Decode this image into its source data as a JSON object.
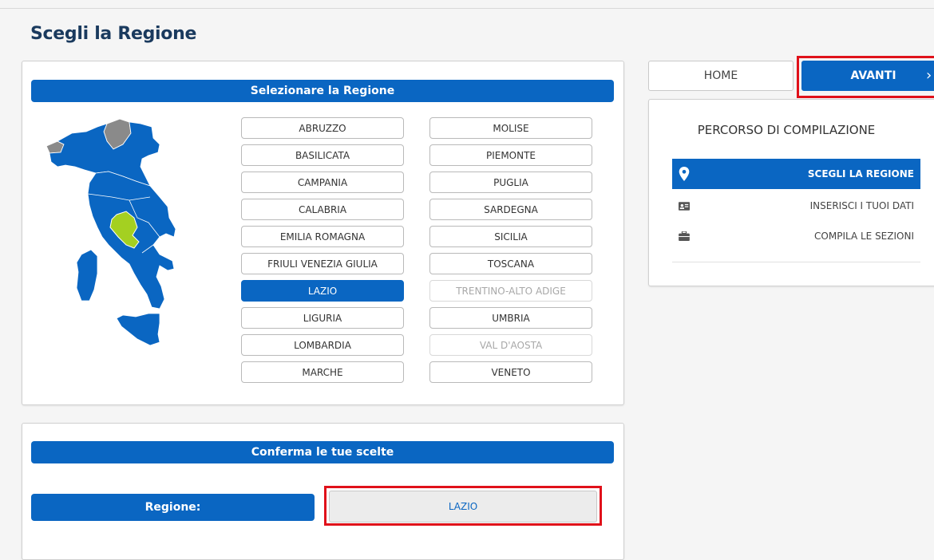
{
  "page_title": "Scegli la Regione",
  "select_card": {
    "header": "Selezionare la Regione",
    "regions_left": [
      {
        "label": "ABRUZZO",
        "state": "normal"
      },
      {
        "label": "BASILICATA",
        "state": "normal"
      },
      {
        "label": "CAMPANIA",
        "state": "normal"
      },
      {
        "label": "CALABRIA",
        "state": "normal"
      },
      {
        "label": "EMILIA ROMAGNA",
        "state": "normal"
      },
      {
        "label": "FRIULI VENEZIA GIULIA",
        "state": "normal"
      },
      {
        "label": "LAZIO",
        "state": "selected"
      },
      {
        "label": "LIGURIA",
        "state": "normal"
      },
      {
        "label": "LOMBARDIA",
        "state": "normal"
      },
      {
        "label": "MARCHE",
        "state": "normal"
      }
    ],
    "regions_right": [
      {
        "label": "MOLISE",
        "state": "normal"
      },
      {
        "label": "PIEMONTE",
        "state": "normal"
      },
      {
        "label": "PUGLIA",
        "state": "normal"
      },
      {
        "label": "SARDEGNA",
        "state": "normal"
      },
      {
        "label": "SICILIA",
        "state": "normal"
      },
      {
        "label": "TOSCANA",
        "state": "normal"
      },
      {
        "label": "TRENTINO-ALTO ADIGE",
        "state": "disabled"
      },
      {
        "label": "UMBRIA",
        "state": "normal"
      },
      {
        "label": "VAL D'AOSTA",
        "state": "disabled"
      },
      {
        "label": "VENETO",
        "state": "normal"
      }
    ]
  },
  "confirm_card": {
    "header": "Conferma le tue scelte",
    "region_label": "Regione:",
    "region_value": "LAZIO"
  },
  "nav": {
    "home_label": "HOME",
    "next_label": "AVANTI",
    "next_icon": "chevron-right-icon"
  },
  "path": {
    "title": "PERCORSO DI COMPILAZIONE",
    "steps": [
      {
        "label": "SCEGLI LA REGIONE",
        "icon": "map-pin-icon",
        "active": true
      },
      {
        "label": "INSERISCI I TUOI DATI",
        "icon": "id-card-icon",
        "active": false
      },
      {
        "label": "COMPILA LE SEZIONI",
        "icon": "briefcase-icon",
        "active": false
      }
    ]
  },
  "colors": {
    "primary": "#0a66c2",
    "highlight": "#e0111a",
    "selected_region": "#a4d021",
    "disabled_region": "#8a8a8a"
  }
}
